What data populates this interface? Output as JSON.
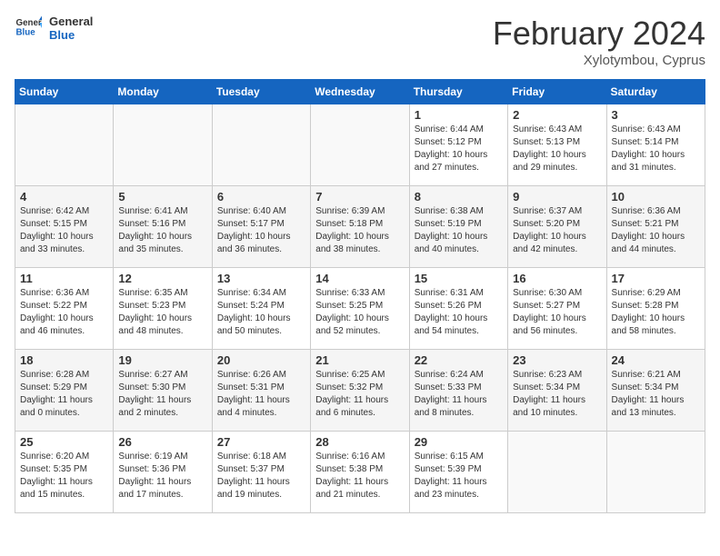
{
  "header": {
    "logo_general": "General",
    "logo_blue": "Blue",
    "month_title": "February 2024",
    "subtitle": "Xylotymbou, Cyprus"
  },
  "days_of_week": [
    "Sunday",
    "Monday",
    "Tuesday",
    "Wednesday",
    "Thursday",
    "Friday",
    "Saturday"
  ],
  "weeks": [
    [
      {
        "day": "",
        "info": ""
      },
      {
        "day": "",
        "info": ""
      },
      {
        "day": "",
        "info": ""
      },
      {
        "day": "",
        "info": ""
      },
      {
        "day": "1",
        "info": "Sunrise: 6:44 AM\nSunset: 5:12 PM\nDaylight: 10 hours\nand 27 minutes."
      },
      {
        "day": "2",
        "info": "Sunrise: 6:43 AM\nSunset: 5:13 PM\nDaylight: 10 hours\nand 29 minutes."
      },
      {
        "day": "3",
        "info": "Sunrise: 6:43 AM\nSunset: 5:14 PM\nDaylight: 10 hours\nand 31 minutes."
      }
    ],
    [
      {
        "day": "4",
        "info": "Sunrise: 6:42 AM\nSunset: 5:15 PM\nDaylight: 10 hours\nand 33 minutes."
      },
      {
        "day": "5",
        "info": "Sunrise: 6:41 AM\nSunset: 5:16 PM\nDaylight: 10 hours\nand 35 minutes."
      },
      {
        "day": "6",
        "info": "Sunrise: 6:40 AM\nSunset: 5:17 PM\nDaylight: 10 hours\nand 36 minutes."
      },
      {
        "day": "7",
        "info": "Sunrise: 6:39 AM\nSunset: 5:18 PM\nDaylight: 10 hours\nand 38 minutes."
      },
      {
        "day": "8",
        "info": "Sunrise: 6:38 AM\nSunset: 5:19 PM\nDaylight: 10 hours\nand 40 minutes."
      },
      {
        "day": "9",
        "info": "Sunrise: 6:37 AM\nSunset: 5:20 PM\nDaylight: 10 hours\nand 42 minutes."
      },
      {
        "day": "10",
        "info": "Sunrise: 6:36 AM\nSunset: 5:21 PM\nDaylight: 10 hours\nand 44 minutes."
      }
    ],
    [
      {
        "day": "11",
        "info": "Sunrise: 6:36 AM\nSunset: 5:22 PM\nDaylight: 10 hours\nand 46 minutes."
      },
      {
        "day": "12",
        "info": "Sunrise: 6:35 AM\nSunset: 5:23 PM\nDaylight: 10 hours\nand 48 minutes."
      },
      {
        "day": "13",
        "info": "Sunrise: 6:34 AM\nSunset: 5:24 PM\nDaylight: 10 hours\nand 50 minutes."
      },
      {
        "day": "14",
        "info": "Sunrise: 6:33 AM\nSunset: 5:25 PM\nDaylight: 10 hours\nand 52 minutes."
      },
      {
        "day": "15",
        "info": "Sunrise: 6:31 AM\nSunset: 5:26 PM\nDaylight: 10 hours\nand 54 minutes."
      },
      {
        "day": "16",
        "info": "Sunrise: 6:30 AM\nSunset: 5:27 PM\nDaylight: 10 hours\nand 56 minutes."
      },
      {
        "day": "17",
        "info": "Sunrise: 6:29 AM\nSunset: 5:28 PM\nDaylight: 10 hours\nand 58 minutes."
      }
    ],
    [
      {
        "day": "18",
        "info": "Sunrise: 6:28 AM\nSunset: 5:29 PM\nDaylight: 11 hours\nand 0 minutes."
      },
      {
        "day": "19",
        "info": "Sunrise: 6:27 AM\nSunset: 5:30 PM\nDaylight: 11 hours\nand 2 minutes."
      },
      {
        "day": "20",
        "info": "Sunrise: 6:26 AM\nSunset: 5:31 PM\nDaylight: 11 hours\nand 4 minutes."
      },
      {
        "day": "21",
        "info": "Sunrise: 6:25 AM\nSunset: 5:32 PM\nDaylight: 11 hours\nand 6 minutes."
      },
      {
        "day": "22",
        "info": "Sunrise: 6:24 AM\nSunset: 5:33 PM\nDaylight: 11 hours\nand 8 minutes."
      },
      {
        "day": "23",
        "info": "Sunrise: 6:23 AM\nSunset: 5:34 PM\nDaylight: 11 hours\nand 10 minutes."
      },
      {
        "day": "24",
        "info": "Sunrise: 6:21 AM\nSunset: 5:34 PM\nDaylight: 11 hours\nand 13 minutes."
      }
    ],
    [
      {
        "day": "25",
        "info": "Sunrise: 6:20 AM\nSunset: 5:35 PM\nDaylight: 11 hours\nand 15 minutes."
      },
      {
        "day": "26",
        "info": "Sunrise: 6:19 AM\nSunset: 5:36 PM\nDaylight: 11 hours\nand 17 minutes."
      },
      {
        "day": "27",
        "info": "Sunrise: 6:18 AM\nSunset: 5:37 PM\nDaylight: 11 hours\nand 19 minutes."
      },
      {
        "day": "28",
        "info": "Sunrise: 6:16 AM\nSunset: 5:38 PM\nDaylight: 11 hours\nand 21 minutes."
      },
      {
        "day": "29",
        "info": "Sunrise: 6:15 AM\nSunset: 5:39 PM\nDaylight: 11 hours\nand 23 minutes."
      },
      {
        "day": "",
        "info": ""
      },
      {
        "day": "",
        "info": ""
      }
    ]
  ]
}
